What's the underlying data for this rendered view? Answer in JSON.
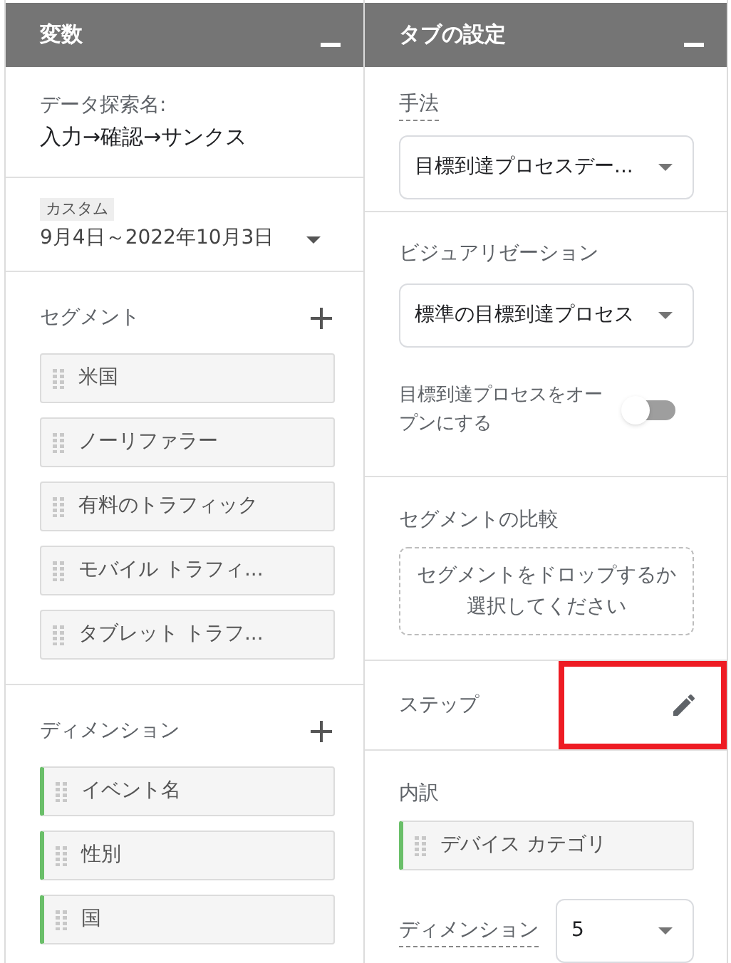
{
  "variables_panel": {
    "title": "変数",
    "exploration_name": {
      "label": "データ探索名:",
      "value": "入力→確認→サンクス"
    },
    "date_range": {
      "badge": "カスタム",
      "value": "9月4日～2022年10月3日"
    },
    "segments": {
      "title": "セグメント",
      "items": [
        {
          "label": "米国"
        },
        {
          "label": "ノーリファラー"
        },
        {
          "label": "有料のトラフィック"
        },
        {
          "label": "モバイル トラフィ..."
        },
        {
          "label": "タブレット トラフ..."
        }
      ]
    },
    "dimensions": {
      "title": "ディメンション",
      "items": [
        {
          "label": "イベント名"
        },
        {
          "label": "性別"
        },
        {
          "label": "国"
        }
      ]
    }
  },
  "tab_settings_panel": {
    "title": "タブの設定",
    "technique": {
      "label": "手法",
      "value": "目標到達プロセスデー..."
    },
    "visualization": {
      "label": "ビジュアリゼーション",
      "value": "標準の目標到達プロセス"
    },
    "open_funnel": {
      "label": "目標到達プロセスをオープンにする",
      "on": false
    },
    "segment_comparison": {
      "label": "セグメントの比較",
      "placeholder": "セグメントをドロップするか選択してください"
    },
    "steps": {
      "label": "ステップ",
      "highlighted": true
    },
    "breakdown": {
      "label": "内訳",
      "item": "デバイス カテゴリ"
    },
    "dimension_count": {
      "label": "ディメンション",
      "value": "5"
    }
  }
}
